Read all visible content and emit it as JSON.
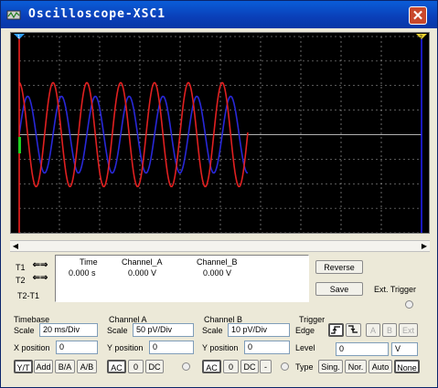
{
  "window": {
    "title": "Oscilloscope-XSC1",
    "close_label": "✕"
  },
  "readout": {
    "t1_label": "T1",
    "t2_label": "T2",
    "t2t1_label": "T2-T1",
    "headers": [
      "Time",
      "Channel_A",
      "Channel_B"
    ],
    "t1_values": [
      "0.000 s",
      "0.000 V",
      "0.000 V"
    ]
  },
  "buttons": {
    "reverse": "Reverse",
    "save": "Save",
    "ext_trigger": "Ext. Trigger"
  },
  "timebase": {
    "group_label": "Timebase",
    "scale_label": "Scale",
    "scale_value": "20 ms/Div",
    "xpos_label": "X position",
    "xpos_value": "0",
    "modes": [
      "Y/T",
      "Add",
      "B/A",
      "A/B"
    ]
  },
  "channel_a": {
    "group_label": "Channel A",
    "scale_label": "Scale",
    "scale_value": "50 pV/Div",
    "ypos_label": "Y position",
    "ypos_value": "0",
    "coupling": [
      "AC",
      "0",
      "DC"
    ]
  },
  "channel_b": {
    "group_label": "Channel B",
    "scale_label": "Scale",
    "scale_value": "10 pV/Div",
    "ypos_label": "Y position",
    "ypos_value": "0",
    "coupling": [
      "AC",
      "0",
      "DC",
      "-"
    ]
  },
  "trigger": {
    "group_label": "Trigger",
    "edge_label": "Edge",
    "sources": [
      "A",
      "B",
      "Ext"
    ],
    "level_label": "Level",
    "level_value": "0",
    "level_unit": "V",
    "type_label": "Type",
    "types": [
      "Sing.",
      "Nor.",
      "Auto",
      "None"
    ]
  },
  "colors": {
    "channel_a_trace": "#e02020",
    "channel_b_trace": "#2828d8",
    "screen": "#000000",
    "grid": "#b0b0b0",
    "cursor_t1": "#ff2020",
    "cursor_t2": "#2020ff"
  }
}
